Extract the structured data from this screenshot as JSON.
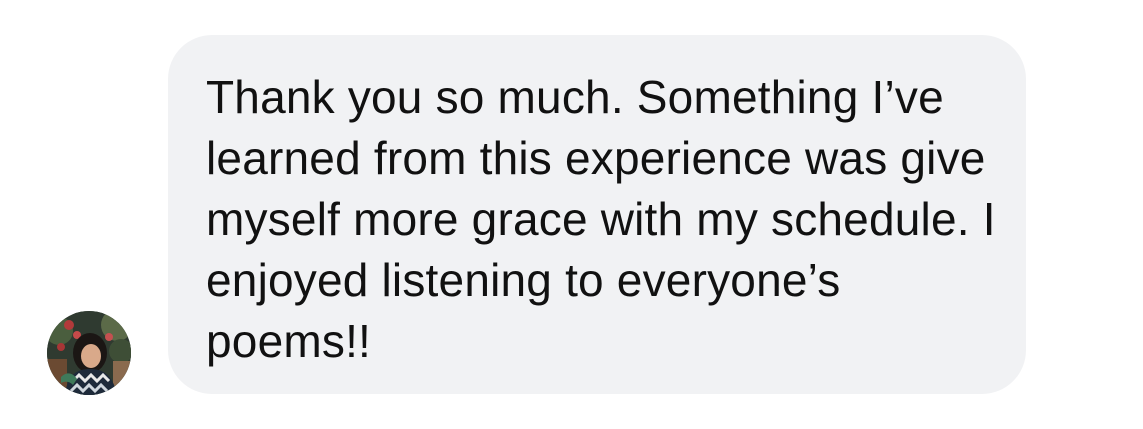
{
  "message": {
    "sender_avatar_icon": "profile-photo",
    "text": "Thank you so much. Something I’ve learned from this experience was give myself more grace with my schedule. I enjoyed listening to everyone’s poems!!",
    "bubble_color": "#f1f2f4",
    "text_color": "#111111"
  }
}
